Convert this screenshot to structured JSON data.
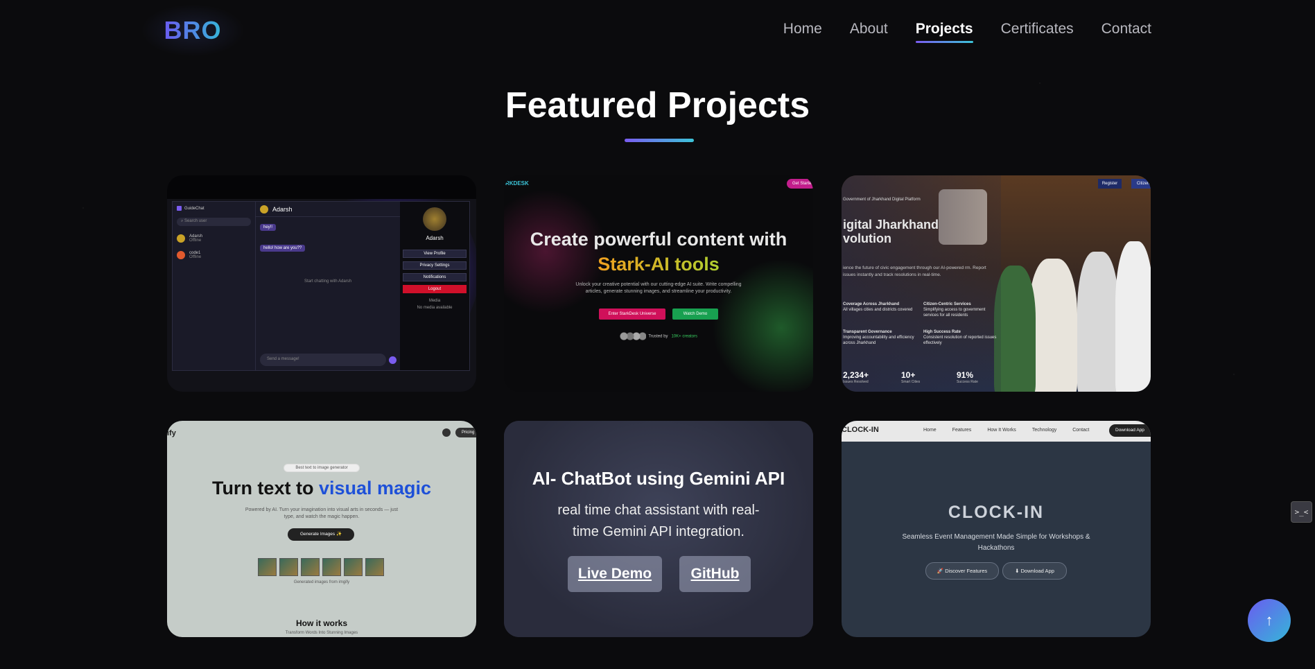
{
  "nav": {
    "logo": "BRO",
    "items": [
      {
        "label": "Home",
        "active": false
      },
      {
        "label": "About",
        "active": false
      },
      {
        "label": "Projects",
        "active": true
      },
      {
        "label": "Certificates",
        "active": false
      },
      {
        "label": "Contact",
        "active": false
      }
    ]
  },
  "section": {
    "title": "Featured Projects"
  },
  "projects": [
    {
      "name": "chat-app",
      "screenshot": {
        "app": "GuideChat",
        "search": "Search user",
        "users": [
          {
            "name": "Adarsh",
            "status": "Offline"
          },
          {
            "name": "code1",
            "status": "Offline"
          }
        ],
        "chat_user": "Adarsh",
        "messages": [
          "hey!!",
          "hello! how are you??"
        ],
        "empty_text": "Start chatting with Adarsh",
        "input_placeholder": "Send a message!",
        "profile_name": "Adarsh",
        "profile_buttons": [
          "View Profile",
          "Privacy Settings",
          "Notifications",
          "Logout"
        ],
        "media_label": "Media",
        "media_empty": "No media available"
      }
    },
    {
      "name": "stark-ai",
      "screenshot": {
        "brand": "RKDESK",
        "top_button": "Get Started",
        "headline_1": "Create powerful content with",
        "headline_2": "Stark-AI tools",
        "subtext": "Unlock your creative potential with our cutting-edge AI suite. Write compelling articles, generate stunning images, and streamline your productivity.",
        "button_1": "Enter StarkDesk Universe",
        "button_2": "Watch Demo",
        "trusted": "Trusted by",
        "trusted_count": "10K+ creators"
      }
    },
    {
      "name": "digital-jharkhand",
      "screenshot": {
        "buttons": [
          "Register",
          "Citizen"
        ],
        "kicker": "Government of Jharkhand Digital Platform",
        "title_1": "igital Jharkhand",
        "title_2": "volution",
        "desc": "ience the future of civic engagement through our AI-powered rm. Report issues instantly and track resolutions in real-time.",
        "features": [
          {
            "title": "Coverage Across Jharkhand",
            "text": "All villages cities and districts covered"
          },
          {
            "title": "Citizen-Centric Services",
            "text": "Simplifying access to government services for all residents"
          },
          {
            "title": "Transparent Governance",
            "text": "Improving accountability and efficiency across Jharkhand"
          },
          {
            "title": "High Success Rate",
            "text": "Consistent resolution of reported issues effectively"
          }
        ],
        "stats": [
          {
            "value": "2,234+",
            "label": "Issues Resolved"
          },
          {
            "value": "10+",
            "label": "Smart Cities"
          },
          {
            "value": "91%",
            "label": "Success Rate"
          }
        ]
      }
    },
    {
      "name": "imgify",
      "screenshot": {
        "brand": "ify",
        "pricing": "Pricing",
        "tag": "Best text to image generator",
        "headline_1": "Turn text to ",
        "headline_2": "visual magic",
        "subtext": "Powered by AI. Turn your imagination into visual arts in seconds — just type, and watch the magic happen.",
        "button": "Generate Images ✨",
        "caption": "Generated images from imgify",
        "how_title": "How it works",
        "how_sub": "Transform Words Into Stunning Images"
      }
    },
    {
      "name": "gemini-chatbot",
      "title": "AI- ChatBot using Gemini API",
      "description": "real time chat assistant with real-time Gemini API integration.",
      "live_demo": "Live Demo",
      "github": "GitHub"
    },
    {
      "name": "clock-in",
      "screenshot": {
        "brand": "CLOCK-IN",
        "links": [
          "Home",
          "Features",
          "How It Works",
          "Technology",
          "Contact"
        ],
        "download": "Download App",
        "title": "CLOCK-IN",
        "subtext": "Seamless Event Management Made Simple for Workshops & Hackathons",
        "button_1": "🚀 Discover Features",
        "button_2": "⬇ Download App"
      }
    }
  ],
  "floating": {
    "side_icon": ">_<",
    "scroll_top": "↑"
  },
  "colors": {
    "accent_start": "#6a5cf0",
    "accent_end": "#35b6d8",
    "background": "#0b0b0d"
  }
}
